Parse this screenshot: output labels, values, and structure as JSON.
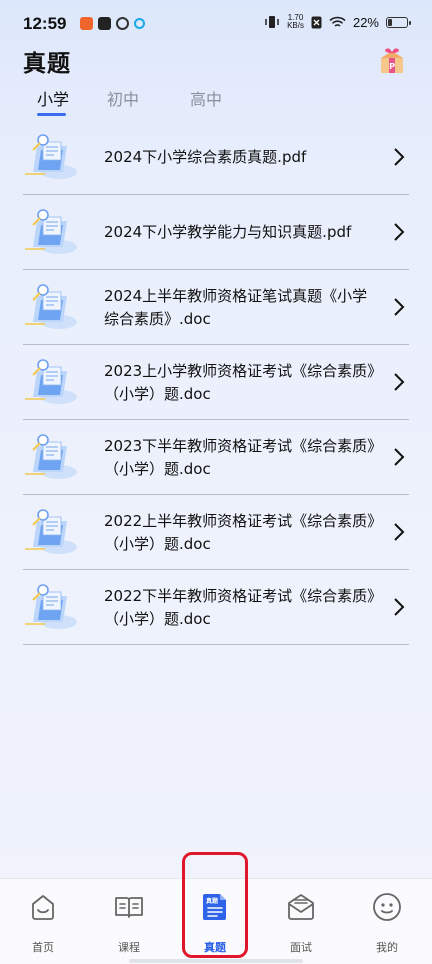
{
  "status_bar": {
    "time": "12:59",
    "speed_value": "1.70",
    "speed_unit": "KB/s",
    "battery": "22%"
  },
  "header": {
    "title": "真题"
  },
  "tabs": [
    {
      "label": "小学",
      "active": true
    },
    {
      "label": "初中",
      "active": false
    },
    {
      "label": "高中",
      "active": false
    }
  ],
  "files": [
    {
      "name": "2024下小学综合素质真题.pdf"
    },
    {
      "name": "2024下小学教学能力与知识真题.pdf"
    },
    {
      "name": "2024上半年教师资格证笔试真题《小学综合素质》.doc"
    },
    {
      "name": "2023上小学教师资格证考试《综合素质》（小学）题.doc"
    },
    {
      "name": "2023下半年教师资格证考试《综合素质》（小学）题.doc"
    },
    {
      "name": "2022上半年教师资格证考试《综合素质》（小学）题.doc"
    },
    {
      "name": "2022下半年教师资格证考试《综合素质》（小学）题.doc"
    }
  ],
  "bottom_nav": [
    {
      "label": "首页",
      "icon": "home-face-icon"
    },
    {
      "label": "课程",
      "icon": "open-book-icon"
    },
    {
      "label": "真题",
      "icon": "document-icon",
      "icon_text": "真题",
      "active": true
    },
    {
      "label": "面试",
      "icon": "envelope-icon"
    },
    {
      "label": "我的",
      "icon": "profile-face-icon"
    }
  ],
  "colors": {
    "accent": "#2a5fe6",
    "highlight": "#e0162b"
  }
}
